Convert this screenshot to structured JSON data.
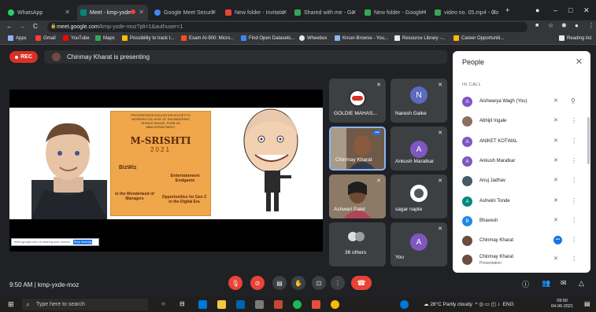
{
  "browser": {
    "tabs": [
      {
        "label": "WhatsApp",
        "color": "#25d366"
      },
      {
        "label": "Meet - kmp-yxde",
        "color": "#00897b"
      },
      {
        "label": "Google Meet Securit",
        "color": "#4285f4"
      },
      {
        "label": "New folder - Invitatio",
        "color": "#ea4335"
      },
      {
        "label": "Shared with me - Go",
        "color": "#34a853"
      },
      {
        "label": "New folder - Google I",
        "color": "#34a853"
      },
      {
        "label": "video no. 05.mp4 - Go",
        "color": "#34a853"
      }
    ],
    "url_host": "meet.google.com",
    "url_path": "/kmp-yxde-moz?pli=1&authuser=1",
    "bookmarks": [
      "Apps",
      "Gmail",
      "YouTube",
      "Maps",
      "Possibility to track t...",
      "Exam AI-900: Micro...",
      "Find Open Datasets...",
      "Wheebox",
      "Kncer-Browse - You...",
      "Resource Library -...",
      "Career Opportuniti..."
    ],
    "reading_list": "Reading list"
  },
  "meet": {
    "rec_label": "REC",
    "presenting_label": "Chinmay Kharat is presenting",
    "slide": {
      "poster_header": "PROGRESSIVE EDUCATION SOCIETY'S\nMODERN COLLEGE OF ENGINEERING\nSHIVAJI NAGAR, PUNE-05\nMBA DEPARTMENT",
      "poster_title": "M-SRISHTI",
      "poster_year": "2021",
      "poster_bizwiz": "BizWiz",
      "poster_entertainment": "Entertainment Endgame",
      "poster_wonderland": "in the Wonderland of Managers",
      "poster_opportunities": "Opportunities for Gen Z in the Digital Era",
      "share_bar_text": "meet.google.com is sharing your screen.",
      "share_bar_button": "Stop sharing"
    },
    "tiles": [
      {
        "name": "GOLDIE MAHAS...",
        "initial": "",
        "color": "#ffffff"
      },
      {
        "name": "Naresh Gaike",
        "initial": "N",
        "color": "#5c6bc0"
      },
      {
        "name": "Chinmay Kharat",
        "initial": "",
        "color": ""
      },
      {
        "name": "Ankush Maratkar",
        "initial": "A",
        "color": "#7e57c2"
      },
      {
        "name": "Ashwari Patel",
        "initial": "",
        "color": ""
      },
      {
        "name": "sagar napte",
        "initial": "",
        "color": ""
      },
      {
        "name": "36 others",
        "initial": "",
        "color": ""
      },
      {
        "name": "You",
        "initial": "A",
        "color": "#7e57c2"
      }
    ],
    "clock": "9:50 AM",
    "meeting_code": "kmp-yxde-moz"
  },
  "people": {
    "title": "People",
    "section": "IN CALL",
    "participants": [
      {
        "name": "Aishwarya Wagh (You)",
        "initial": "A",
        "color": "#7e57c2",
        "sub": ""
      },
      {
        "name": "Abhijit Ingale",
        "initial": "",
        "color": "#8d6e63",
        "sub": ""
      },
      {
        "name": "ANIKET KOTWAL",
        "initial": "A",
        "color": "#7e57c2",
        "sub": ""
      },
      {
        "name": "Ankush Maratkar",
        "initial": "A",
        "color": "#7e57c2",
        "sub": ""
      },
      {
        "name": "Anuj Jadhav",
        "initial": "",
        "color": "#455a64",
        "sub": ""
      },
      {
        "name": "Ashwini Tonde",
        "initial": "A",
        "color": "#00897b",
        "sub": ""
      },
      {
        "name": "Bhavesh",
        "initial": "B",
        "color": "#1e88e5",
        "sub": ""
      },
      {
        "name": "Chinmay Kharat",
        "initial": "",
        "color": "#6d4c41",
        "sub": ""
      },
      {
        "name": "Chinmay Kharat",
        "initial": "",
        "color": "#6d4c41",
        "sub": "Presentation"
      }
    ]
  },
  "taskbar": {
    "search_placeholder": "Type here to search",
    "weather": "28°C Partly cloudy",
    "lang": "ENG",
    "time": "09:50",
    "date": "04-06-2021"
  }
}
